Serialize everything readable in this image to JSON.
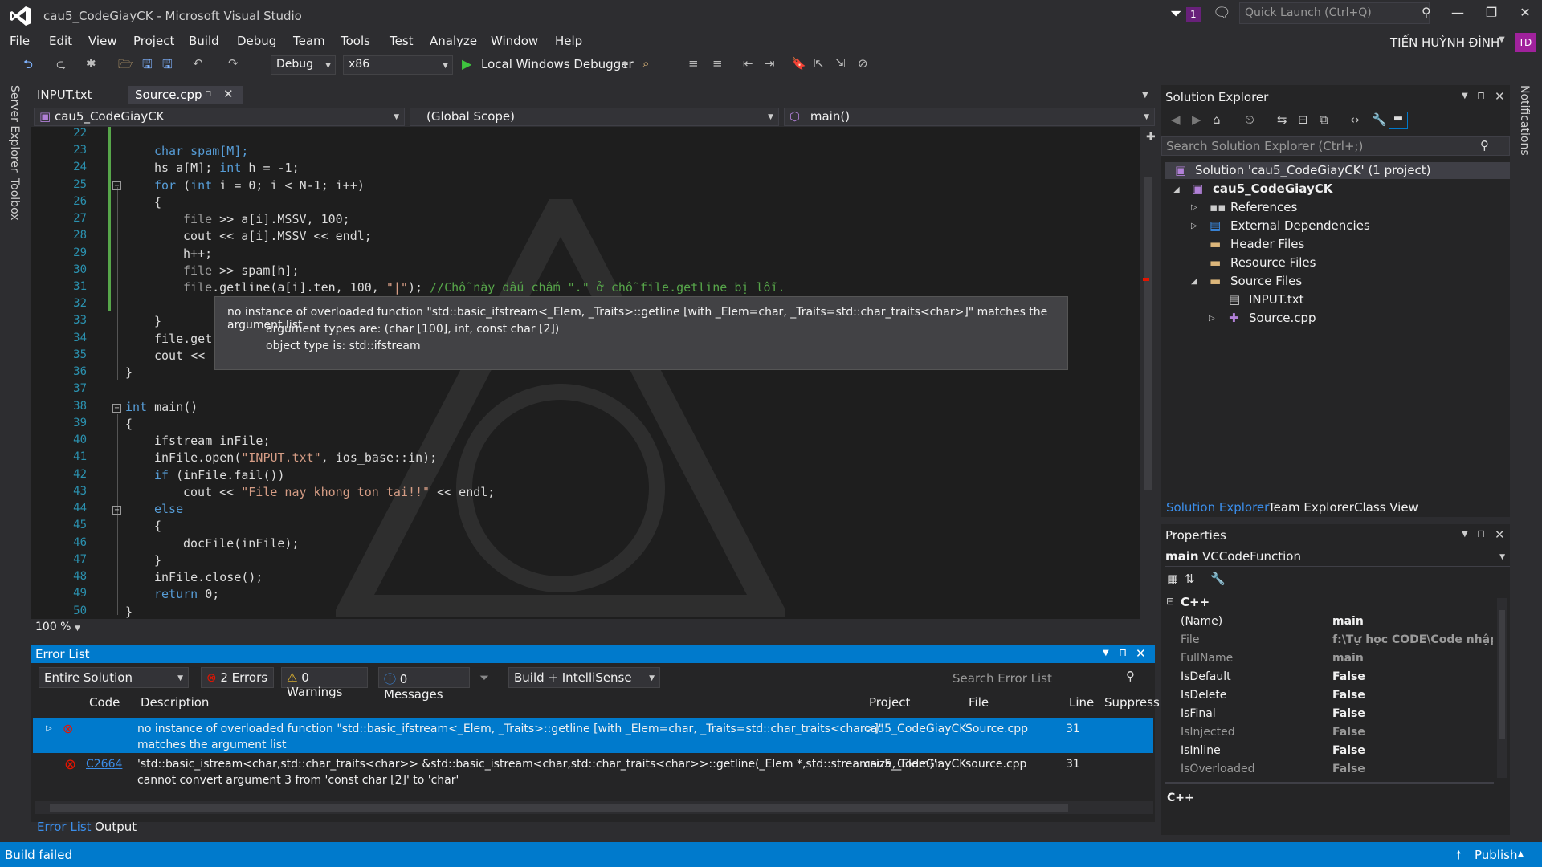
{
  "window": {
    "title": "cau5_CodeGiayCK - Microsoft Visual Studio",
    "notification_count": "1",
    "quick_launch_placeholder": "Quick Launch (Ctrl+Q)",
    "user_name": "TIẾN HUỲNH ĐÌNH",
    "user_initials": "TD"
  },
  "menu": [
    "File",
    "Edit",
    "View",
    "Project",
    "Build",
    "Debug",
    "Team",
    "Tools",
    "Test",
    "Analyze",
    "Window",
    "Help"
  ],
  "toolbar": {
    "configuration": "Debug",
    "platform": "x86",
    "debugger": "Local Windows Debugger"
  },
  "side_tools": {
    "server_explorer": "Server Explorer",
    "toolbox": "Toolbox",
    "notifications": "Notifications"
  },
  "tabs": [
    {
      "label": "INPUT.txt"
    },
    {
      "label": "Source.cpp"
    }
  ],
  "navbar": {
    "project": "cau5_CodeGiayCK",
    "scope": "(Global Scope)",
    "member": "main()"
  },
  "editor": {
    "zoom": "100 %",
    "line_numbers": [
      "22",
      "23",
      "24",
      "25",
      "26",
      "27",
      "28",
      "29",
      "30",
      "31",
      "32",
      "33",
      "34",
      "35",
      "36",
      "37",
      "38",
      "39",
      "40",
      "41",
      "42",
      "43",
      "44",
      "45",
      "46",
      "47",
      "48",
      "49",
      "50"
    ],
    "code": {
      "l23": "char spam[M];",
      "l24a": "hs a[M]; ",
      "l24b": "int",
      "l24c": " h = -1;",
      "l25a": "for",
      "l25b": " (",
      "l25c": "int",
      "l25d": " i = 0; i < N-1; i++)",
      "l26": "{",
      "l27a": "file",
      "l27b": " >> a[i].MSSV, 100;",
      "l28": "cout << a[i].MSSV << endl;",
      "l29": "h++;",
      "l30a": "file",
      "l30b": " >> spam[h];",
      "l31a": "file",
      "l31b": ".getline(a[i].ten, 100, ",
      "l31c": "\"|\"",
      "l31d": "); ",
      "l31e": "//Chỗ này dấu chấm \".\" ở chỗ file.getline bị lỗi.",
      "l33": "}",
      "l34": "file.get",
      "l35": "cout << .",
      "l36": "}",
      "l38a": "int",
      "l38b": " main()",
      "l39": "{",
      "l40": "ifstream inFile;",
      "l41a": "inFile.open(",
      "l41b": "\"INPUT.txt\"",
      "l41c": ", ios_base::in);",
      "l42a": "if",
      "l42b": " (inFile.fail())",
      "l43a": "cout << ",
      "l43b": "\"File nay khong ton tai!!\"",
      "l43c": " << endl;",
      "l44": "else",
      "l45": "{",
      "l46": "docFile(inFile);",
      "l47": "}",
      "l48": "inFile.close();",
      "l49a": "return",
      "l49b": " 0;",
      "l50": "}"
    },
    "tooltip": {
      "line1": "no instance of overloaded function \"std::basic_ifstream<_Elem, _Traits>::getline [with _Elem=char, _Traits=std::char_traits<char>]\" matches the argument list",
      "line2": "argument types are: (char [100], int, const char [2])",
      "line3": "object type is: std::ifstream"
    }
  },
  "error_list": {
    "title": "Error List",
    "scope": "Entire Solution",
    "errors_btn": "2 Errors",
    "warnings_btn": "0 Warnings",
    "messages_btn": "0 Messages",
    "source_filter": "Build + IntelliSense",
    "search_placeholder": "Search Error List",
    "columns": [
      "Code",
      "Description",
      "Project",
      "File",
      "Line",
      "Suppressi"
    ],
    "rows": [
      {
        "code": "",
        "desc1": "no instance of overloaded function \"std::basic_ifstream<_Elem, _Traits>::getline [with _Elem=char, _Traits=std::char_traits<char>]\"",
        "desc2": "matches the argument list",
        "project": "cau5_CodeGiayCK",
        "file": "Source.cpp",
        "line": "31"
      },
      {
        "code": "C2664",
        "desc1": "'std::basic_istream<char,std::char_traits<char>> &std::basic_istream<char,std::char_traits<char>>::getline(_Elem *,std::streamsize,_Elem)':",
        "desc2": "cannot convert argument 3 from 'const char [2]' to 'char'",
        "project": "cau5_CodeGiayCK",
        "file": "source.cpp",
        "line": "31"
      }
    ],
    "bottom_tabs": [
      "Error List",
      "Output"
    ]
  },
  "solution_explorer": {
    "title": "Solution Explorer",
    "search_placeholder": "Search Solution Explorer (Ctrl+;)",
    "solution": "Solution 'cau5_CodeGiayCK' (1 project)",
    "project": "cau5_CodeGiayCK",
    "nodes": [
      "References",
      "External Dependencies",
      "Header Files",
      "Resource Files",
      "Source Files"
    ],
    "source_children": [
      "INPUT.txt",
      "Source.cpp"
    ],
    "bottom_tabs": [
      "Solution Explorer",
      "Team Explorer",
      "Class View"
    ]
  },
  "properties": {
    "title": "Properties",
    "object_name": "main",
    "object_type": "VCCodeFunction",
    "category": "C++",
    "rows": [
      {
        "name": "(Name)",
        "value": "main"
      },
      {
        "name": "File",
        "value": "f:\\Tự học CODE\\Code nhập\\"
      },
      {
        "name": "FullName",
        "value": "main"
      },
      {
        "name": "IsDefault",
        "value": "False"
      },
      {
        "name": "IsDelete",
        "value": "False"
      },
      {
        "name": "IsFinal",
        "value": "False"
      },
      {
        "name": "IsInjected",
        "value": "False"
      },
      {
        "name": "IsInline",
        "value": "False"
      },
      {
        "name": "IsOverloaded",
        "value": "False"
      }
    ],
    "description_label": "C++"
  },
  "status": {
    "text": "Build failed",
    "publish": "Publish"
  },
  "colors": {
    "accent": "#007acc",
    "error": "#e51400",
    "keyword": "#569cd6",
    "string": "#d69d85",
    "comment": "#57a64a"
  }
}
